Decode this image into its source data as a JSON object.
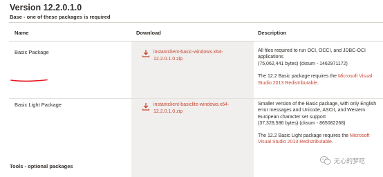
{
  "version_title": "Version 12.2.0.1.0",
  "base_label": "Base - one of these packages is required",
  "table": {
    "headers": {
      "name": "Name",
      "download": "Download",
      "description": "Description"
    },
    "rows": [
      {
        "name": "Basic Package",
        "download_line1": "instantclient-basic-windows.x64-",
        "download_line2": "12.2.0.1.0.zip",
        "desc_p1": "All files required to run OCI, OCCI, and JDBC-OCI applications",
        "desc_size": "(75,062,441 bytes) (cksum - 1462971172)",
        "desc_p2_before": "The 12.2 Basic package requires the ",
        "desc_p2_link": "Microsoft Visual Studio 2013 Redistributable",
        "desc_p2_after": "."
      },
      {
        "name": "Basic Light Package",
        "download_line1": "instantclient-basiclite-windows.x64-",
        "download_line2": "12.2.0.1.0.zip",
        "desc_p1": "Smaller version of the Basic package, with only English error messages and Unicode, ASCII, and Western European character set support",
        "desc_size": "(37,328,586 bytes) (cksum - 865082268)",
        "desc_p2_before": "The 12.2 Basic Light package requires the ",
        "desc_p2_link": "Microsoft Visual Studio 2013 Redistributable",
        "desc_p2_after": "."
      }
    ]
  },
  "tools_label": "Tools - optional packages",
  "watermark_text": "无心的梦呓",
  "colors": {
    "accent": "#c74634",
    "underline": "#e8101a",
    "column_bg": "#f1efed"
  }
}
